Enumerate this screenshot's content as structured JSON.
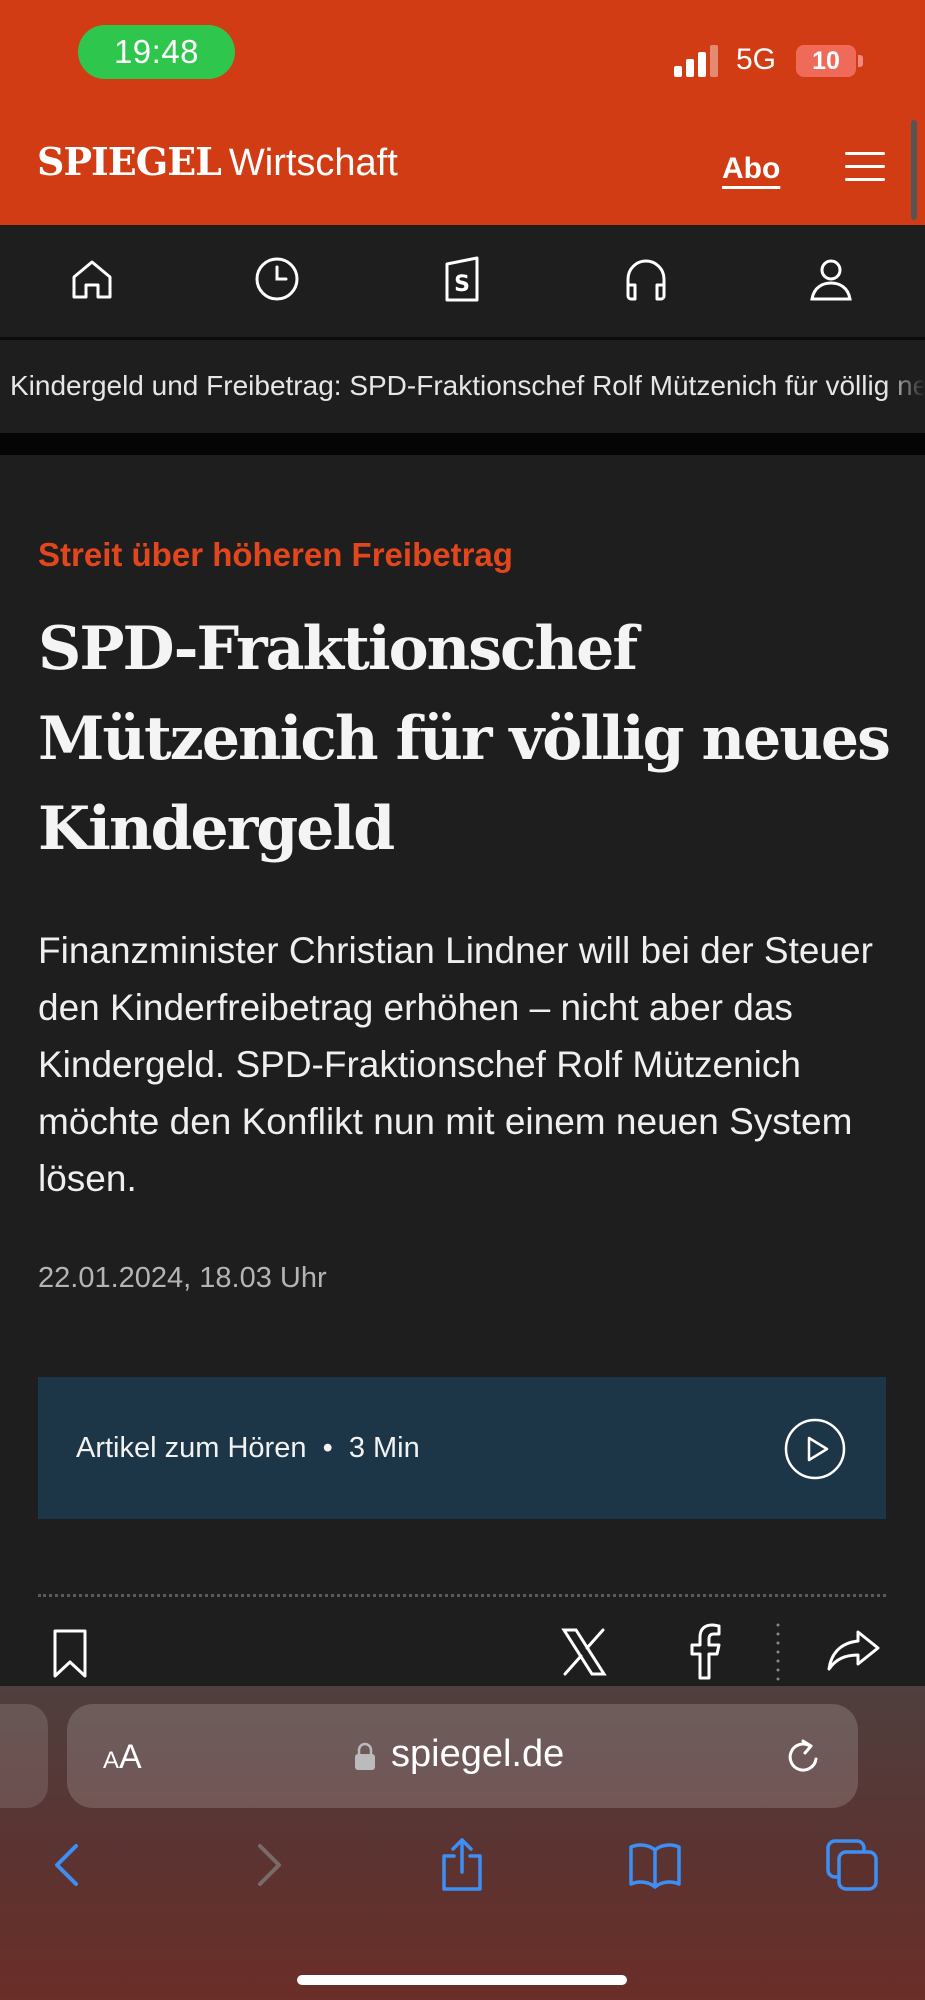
{
  "status_bar": {
    "time": "19:48",
    "network": "5G",
    "battery": "10"
  },
  "header": {
    "logo": "SPIEGEL",
    "section": "Wirtschaft",
    "abo_label": "Abo",
    "menu_icon": "hamburger-menu-icon"
  },
  "icon_nav": [
    {
      "name": "home-icon"
    },
    {
      "name": "history-clock-icon"
    },
    {
      "name": "spiegel-plus-icon"
    },
    {
      "name": "headphones-icon"
    },
    {
      "name": "account-icon"
    }
  ],
  "ticker": {
    "text": "Kindergeld und Freibetrag: SPD-Fraktionschef Rolf Mützenich für völlig neues Kindergeld"
  },
  "article": {
    "kicker": "Streit über höheren Freibetrag",
    "headline": "SPD-Fraktionschef Mützenich für völlig neues Kindergeld",
    "lead": "Finanzminister Christian Lindner will bei der Steuer den Kinderfreibetrag erhöhen – nicht aber das Kindergeld. SPD-Fraktionschef Rolf Mützenich möchte den Konflikt nun mit einem neuen System lösen.",
    "date": "22.01.2024, 18.03 Uhr"
  },
  "audio": {
    "label": "Artikel zum Hören  •  3 Min",
    "color": "#1c3647"
  },
  "share_icons": [
    "bookmark-icon",
    "x-icon",
    "facebook-icon",
    "share-icon"
  ],
  "safari": {
    "text_size_small": "A",
    "text_size_large": "A",
    "url": "spiegel.de",
    "toolbar": [
      "back-icon",
      "forward-icon",
      "share-icon",
      "bookmarks-icon",
      "tabs-icon"
    ]
  },
  "colors": {
    "brand_orange": "#d23c14",
    "kicker_red": "#e2461c",
    "background": "#1e1e1e",
    "status_green": "#2fc64e",
    "safari_blue": "#3d8ff5"
  }
}
